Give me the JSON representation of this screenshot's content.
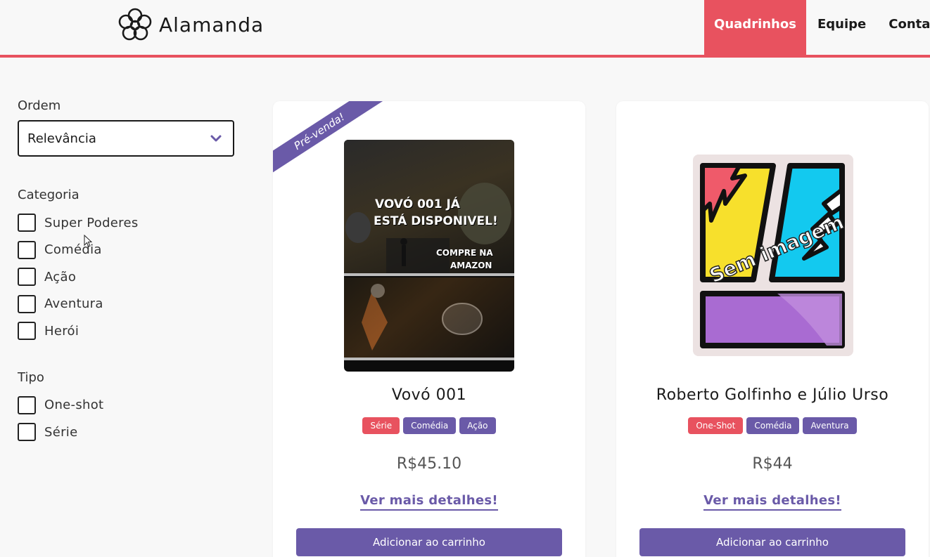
{
  "header": {
    "brand_name": "Alamanda",
    "nav": [
      "Quadrinhos",
      "Equipe",
      "Contat"
    ]
  },
  "sidebar": {
    "order_title": "Ordem",
    "order_value": "Relevância",
    "category_title": "Categoria",
    "categories": [
      "Super Poderes",
      "Comédia",
      "Ação",
      "Aventura",
      "Herói"
    ],
    "type_title": "Tipo",
    "types": [
      "One-shot",
      "Série"
    ]
  },
  "products": [
    {
      "ribbon": "Pré-venda!",
      "cover_text": {
        "headline_1": "VOVÓ 001 JÁ",
        "headline_2": "ESTÁ DISPONIVEL!",
        "cta_1": "COMPRE NA",
        "cta_2": "AMAZON"
      },
      "title": "Vovó 001",
      "tags": [
        "Série",
        "Comédia",
        "Ação"
      ],
      "price": "R$45.10",
      "details_label": "Ver mais detalhes!",
      "add_label": "Adicionar ao carrinho"
    },
    {
      "cover_text": {
        "placeholder": "Sem imagem"
      },
      "title": "Roberto Golfinho e Júlio Urso",
      "tags": [
        "One-Shot",
        "Comédia",
        "Aventura"
      ],
      "price": "R$44",
      "details_label": "Ver mais detalhes!",
      "add_label": "Adicionar ao carrinho"
    }
  ],
  "colors": {
    "accent_red": "#e8525f",
    "accent_purple": "#6a5aa8"
  }
}
